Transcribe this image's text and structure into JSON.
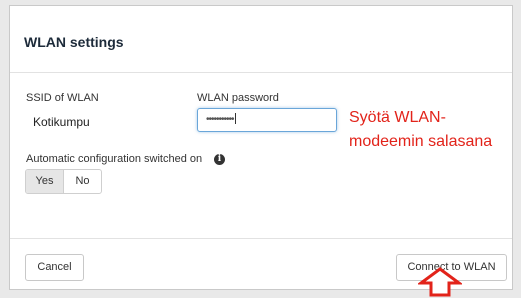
{
  "dialog": {
    "title": "WLAN settings"
  },
  "ssid": {
    "label": "SSID of WLAN",
    "value": "Kotikumpu"
  },
  "password": {
    "label": "WLAN password",
    "masked_value": "•••••••••••"
  },
  "annotation": {
    "line1": "Syötä WLAN-",
    "line2": "modeemin salasana",
    "color": "#e2231a"
  },
  "auto_config": {
    "label": "Automatic configuration switched on",
    "icon": "info-icon",
    "options": [
      "Yes",
      "No"
    ],
    "selected": "Yes"
  },
  "footer": {
    "cancel_label": "Cancel",
    "connect_label": "Connect to WLAN"
  },
  "pointer": {
    "icon": "up-arrow-icon",
    "color": "#e2231a"
  }
}
